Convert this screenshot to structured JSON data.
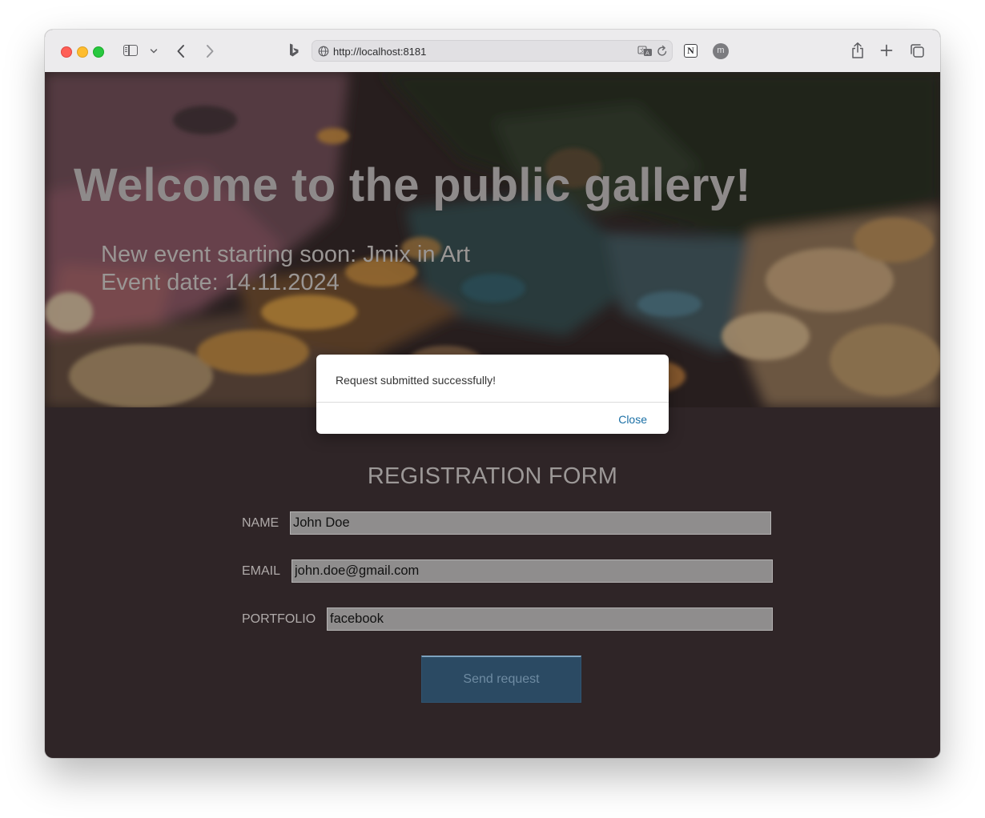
{
  "browser": {
    "url": "http://localhost:8181",
    "bookmark_app_label": "N",
    "profile_initial": "m"
  },
  "hero": {
    "title": "Welcome to the public gallery!",
    "event_line": "New event starting soon: Jmix in Art",
    "date_line": "Event date: 14.11.2024"
  },
  "form": {
    "title": "REGISTRATION FORM",
    "fields": [
      {
        "label": "NAME",
        "value": "John Doe"
      },
      {
        "label": "EMAIL",
        "value": "john.doe@gmail.com"
      },
      {
        "label": "PORTFOLIO",
        "value": "facebook"
      }
    ],
    "submit_label": "Send request"
  },
  "dialog": {
    "message": "Request submitted successfully!",
    "close_label": "Close"
  }
}
